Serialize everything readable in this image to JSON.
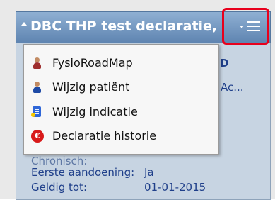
{
  "window": {
    "title": "DBC THP test declaratie, D"
  },
  "background": {
    "d_text": "D",
    "ac_text": "Ac...",
    "chronisch_label": "Chronisch:",
    "eerste_label": "Eerste aandoening:",
    "eerste_value": "Ja",
    "geldig_label": "Geldig tot:",
    "geldig_value": "01-01-2015"
  },
  "menu": {
    "items": [
      {
        "label": "FysioRoadMap",
        "icon": "person-icon"
      },
      {
        "label": "Wijzig patiënt",
        "icon": "person-edit-icon"
      },
      {
        "label": "Wijzig indicatie",
        "icon": "indication-icon"
      },
      {
        "label": "Declaratie historie",
        "icon": "euro-icon"
      }
    ]
  },
  "highlight_color": "#e8001c",
  "header_colors": {
    "top": "#8fb0d3",
    "bottom": "#5f85b1"
  }
}
